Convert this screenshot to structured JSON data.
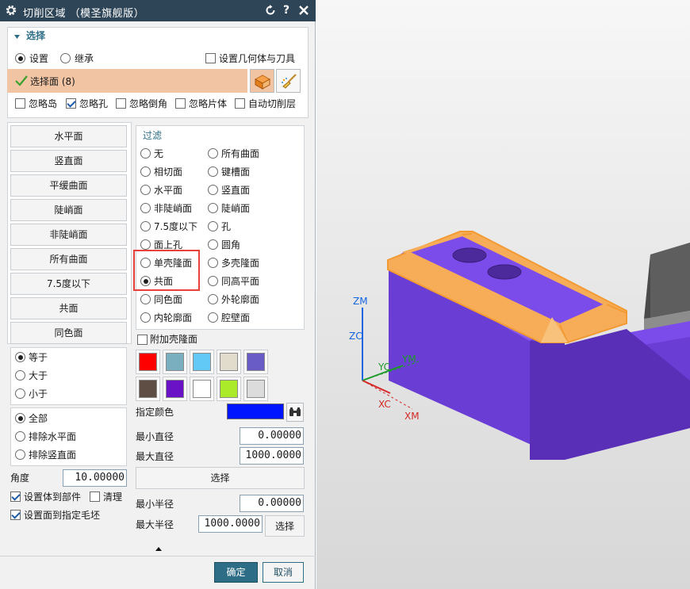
{
  "dialog": {
    "title": "切削区域 （模圣旗舰版）",
    "icons": {
      "settings": "gear-icon",
      "reset": "reset-icon",
      "help": "help-icon",
      "close": "close-icon"
    }
  },
  "selection": {
    "section_label": "选择",
    "mode_options": [
      "设置",
      "继承"
    ],
    "mode_selected": "设置",
    "set_geometry_tool": "设置几何体与刀具",
    "selected_faces": "选择面 (8)",
    "ignore_options": [
      {
        "label": "忽略岛",
        "checked": false
      },
      {
        "label": "忽略孔",
        "checked": true
      },
      {
        "label": "忽略倒角",
        "checked": false
      },
      {
        "label": "忽略片体",
        "checked": false
      },
      {
        "label": "自动切削层",
        "checked": false
      }
    ]
  },
  "quick_buttons": [
    "水平面",
    "竖直面",
    "平缓曲面",
    "陡峭面",
    "非陡峭面",
    "所有曲面",
    "7.5度以下",
    "共面",
    "同色面"
  ],
  "comparison": {
    "options": [
      "等于",
      "大于",
      "小于"
    ],
    "selected": "等于"
  },
  "scope": {
    "options": [
      "全部",
      "排除水平面",
      "排除竖直面"
    ],
    "selected": "全部"
  },
  "angle": {
    "label": "角度",
    "value": "10.00000"
  },
  "set_body_to_part": {
    "label": "设置体到部件",
    "checked": true
  },
  "clean": {
    "label": "清理",
    "checked": false
  },
  "set_face_to_blank": {
    "label": "设置面到指定毛坯",
    "checked": true
  },
  "filter": {
    "title": "过滤",
    "left": [
      "无",
      "相切面",
      "水平面",
      "非陡峭面",
      "7.5度以下",
      "面上孔",
      "单壳隆面",
      "共面",
      "同色面",
      "内轮廓面"
    ],
    "right": [
      "所有曲面",
      "键槽面",
      "竖直面",
      "陡峭面",
      "孔",
      "圆角",
      "多壳隆面",
      "同高平面",
      "外轮廓面",
      "腔壁面"
    ],
    "selected": "共面"
  },
  "add_shell_face": {
    "label": "附加壳隆面",
    "checked": false
  },
  "swatches": [
    "#ff0000",
    "#7aafc0",
    "#62c8f5",
    "#e2dccd",
    "#6a5cc6",
    "#5e4e43",
    "#6a12c6",
    "#ffffff",
    "#aaea2a",
    "#dcdcdc"
  ],
  "specified_color": {
    "label": "指定颜色",
    "value": "#0015ff"
  },
  "min_diameter": {
    "label": "最小直径",
    "value": "0.00000"
  },
  "max_diameter": {
    "label": "最大直径",
    "value": "1000.0000"
  },
  "select_label": "选择",
  "min_radius": {
    "label": "最小半径",
    "value": "0.00000"
  },
  "max_radius": {
    "label": "最大半径",
    "value": "1000.0000"
  },
  "radius_select": "选择",
  "ok": "确定",
  "cancel": "取消",
  "viewport": {
    "axes": [
      "ZM",
      "ZC",
      "YC",
      "YM",
      "XC",
      "XM"
    ],
    "colors": {
      "part": "#6a3ed4",
      "selected_faces": "#f7ad57",
      "other_body": "#6d6d6d"
    }
  }
}
